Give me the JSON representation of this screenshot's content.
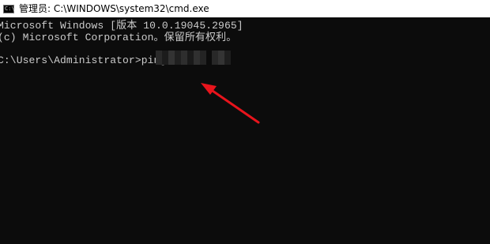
{
  "window": {
    "title": "管理员: C:\\WINDOWS\\system32\\cmd.exe",
    "icon": "cmd-icon"
  },
  "console": {
    "lines": [
      "Microsoft Windows [版本 10.0.19045.2965]",
      "(c) Microsoft Corporation。保留所有权利。",
      "",
      "C:\\Users\\Administrator>ping"
    ],
    "redacted_target": "pixelated"
  },
  "annotation": {
    "arrow_color": "#e8141c"
  }
}
